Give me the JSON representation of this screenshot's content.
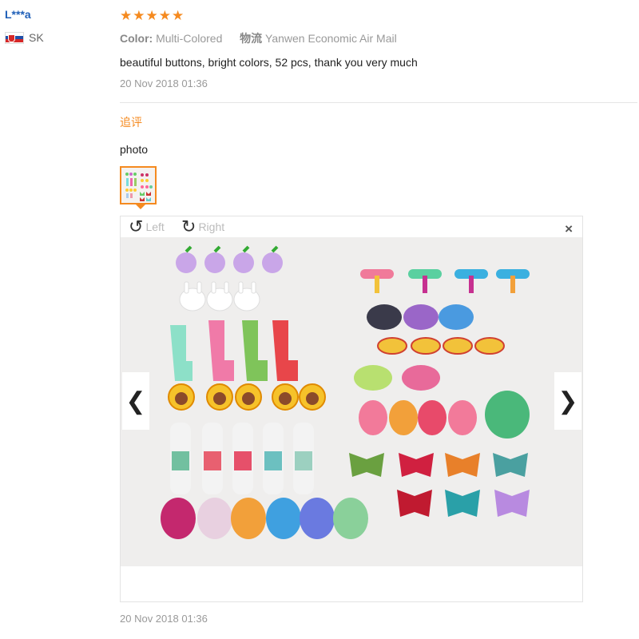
{
  "user": {
    "name": "L***a",
    "country": "SK"
  },
  "review": {
    "stars": "★★★★★",
    "color_label": "Color:",
    "color_value": "Multi-Colored",
    "shipping_label": "物流",
    "shipping_value": "Yanwen Economic Air Mail",
    "comment": "beautiful buttons, bright colors, 52 pcs, thank you very much",
    "date": "20 Nov 2018 01:36"
  },
  "followup": {
    "title": "追评",
    "text": "photo",
    "date": "20 Nov 2018 01:36"
  },
  "viewer": {
    "rotate_left": "Left",
    "rotate_right": "Right",
    "close": "×",
    "prev": "❮",
    "next": "❯"
  },
  "colors": {
    "accent": "#f58a1f",
    "link": "#1f5fb8"
  }
}
